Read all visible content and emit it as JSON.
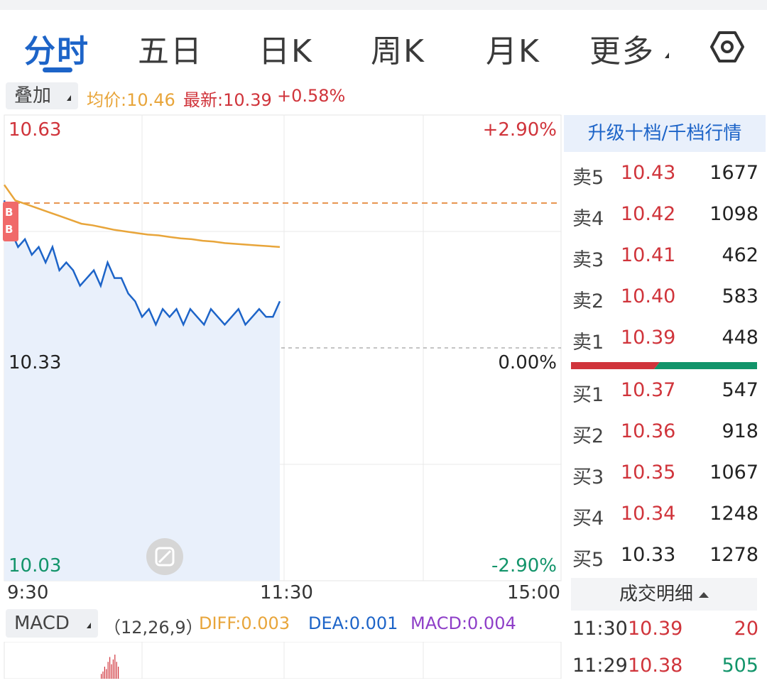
{
  "tabs": [
    {
      "label": "分时",
      "active": true
    },
    {
      "label": "五日"
    },
    {
      "label": "日K"
    },
    {
      "label": "周K"
    },
    {
      "label": "月K"
    },
    {
      "label": "更多"
    }
  ],
  "settings_icon": "settings-hexagon-icon",
  "overlay_label": "叠加",
  "legend": {
    "avg": "均价:10.46",
    "latest": "最新:10.39",
    "change": "+0.58%"
  },
  "colors": {
    "brand_blue": "#1d64c8",
    "up_red": "#d0343b",
    "down_green": "#12946a",
    "avg_line": "#e8a53a",
    "price_line": "#1d64c8",
    "diff": "#e8a53a",
    "dea": "#1d64c8",
    "macd": "#8e3ec8"
  },
  "price_axis": {
    "top_price": "10.63",
    "mid_price": "10.33",
    "bottom_price": "10.03",
    "top_pct": "+2.90%",
    "mid_pct": "0.00%",
    "bottom_pct": "-2.90%"
  },
  "time_axis": {
    "start": "9:30",
    "mid": "11:30",
    "end": "15:00"
  },
  "marker_badges": [
    "B",
    "B"
  ],
  "chart_data": {
    "type": "line",
    "x_range": [
      "9:30",
      "15:00"
    ],
    "ylim": [
      10.03,
      10.63
    ],
    "pre_close": 10.33,
    "series": [
      {
        "name": "均价",
        "role": "avg",
        "values": [
          10.54,
          10.52,
          10.515,
          10.51,
          10.505,
          10.5,
          10.495,
          10.49,
          10.488,
          10.485,
          10.482,
          10.48,
          10.478,
          10.476,
          10.475,
          10.473,
          10.471,
          10.47,
          10.468,
          10.467,
          10.465,
          10.464,
          10.463,
          10.462,
          10.461,
          10.46
        ]
      },
      {
        "name": "最新",
        "role": "price",
        "values": [
          10.52,
          10.48,
          10.46,
          10.47,
          10.45,
          10.46,
          10.44,
          10.46,
          10.43,
          10.44,
          10.43,
          10.41,
          10.42,
          10.43,
          10.41,
          10.44,
          10.42,
          10.42,
          10.4,
          10.39,
          10.37,
          10.38,
          10.36,
          10.38,
          10.37,
          10.38,
          10.36,
          10.38,
          10.37,
          10.36,
          10.38,
          10.37,
          10.36,
          10.37,
          10.38,
          10.36,
          10.37,
          10.38,
          10.37,
          10.37,
          10.39
        ]
      }
    ]
  },
  "macd": {
    "label": "MACD",
    "params": "（12,26,9）",
    "diff": "DIFF:0.003",
    "dea": "DEA:0.001",
    "macd": "MACD:0.004",
    "bars": [
      2,
      3,
      5,
      4,
      7,
      9,
      6,
      8,
      10,
      7,
      5
    ]
  },
  "order_book": {
    "upgrade_label": "升级十档/千档行情",
    "asks": [
      {
        "label": "卖5",
        "price": "10.43",
        "vol": "1677",
        "color": "red"
      },
      {
        "label": "卖4",
        "price": "10.42",
        "vol": "1098",
        "color": "red"
      },
      {
        "label": "卖3",
        "price": "10.41",
        "vol": "462",
        "color": "red"
      },
      {
        "label": "卖2",
        "price": "10.40",
        "vol": "583",
        "color": "red"
      },
      {
        "label": "卖1",
        "price": "10.39",
        "vol": "448",
        "color": "red"
      }
    ],
    "bids": [
      {
        "label": "买1",
        "price": "10.37",
        "vol": "547",
        "color": "red"
      },
      {
        "label": "买2",
        "price": "10.36",
        "vol": "918",
        "color": "red"
      },
      {
        "label": "买3",
        "price": "10.35",
        "vol": "1067",
        "color": "red"
      },
      {
        "label": "买4",
        "price": "10.34",
        "vol": "1248",
        "color": "red"
      },
      {
        "label": "买5",
        "price": "10.33",
        "vol": "1278",
        "color": "black"
      }
    ],
    "buy_ratio": 0.54
  },
  "trades": {
    "header": "成交明细",
    "rows": [
      {
        "time": "11:30",
        "price": "10.39",
        "vol": "20",
        "vol_color": "red"
      },
      {
        "time": "11:29",
        "price": "10.38",
        "vol": "505",
        "vol_color": "green"
      }
    ]
  }
}
